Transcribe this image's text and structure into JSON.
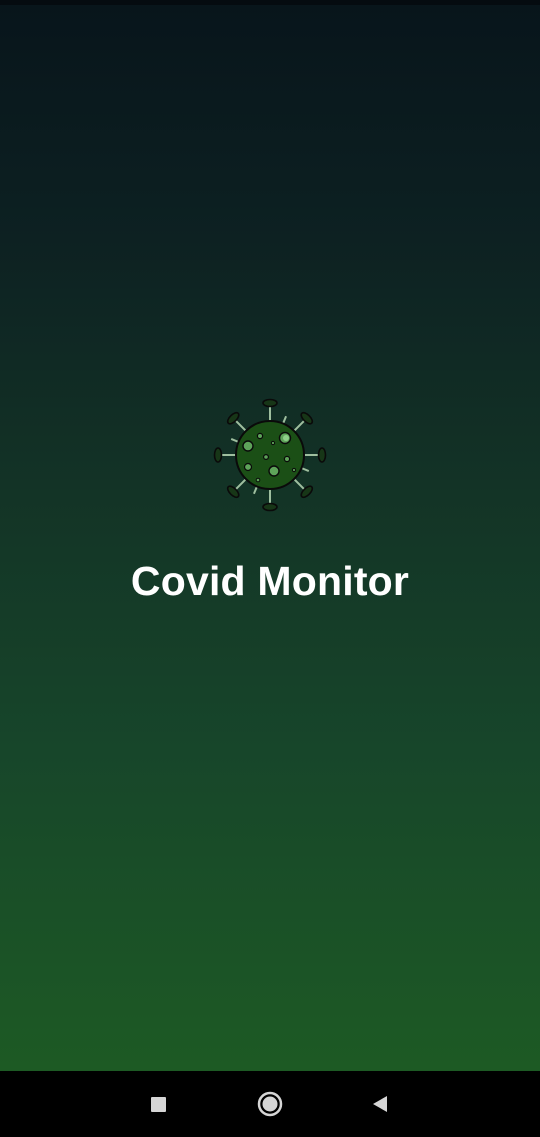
{
  "app": {
    "title": "Covid Monitor",
    "logo_icon": "virus-icon"
  },
  "colors": {
    "gradient_top": "#08151b",
    "gradient_bottom": "#1d5a24",
    "title_text": "#ffffff",
    "nav_background": "#000000",
    "nav_icon": "#d6d6d6"
  },
  "nav": {
    "recents_icon": "square-icon",
    "home_icon": "circle-icon",
    "back_icon": "triangle-back-icon"
  }
}
